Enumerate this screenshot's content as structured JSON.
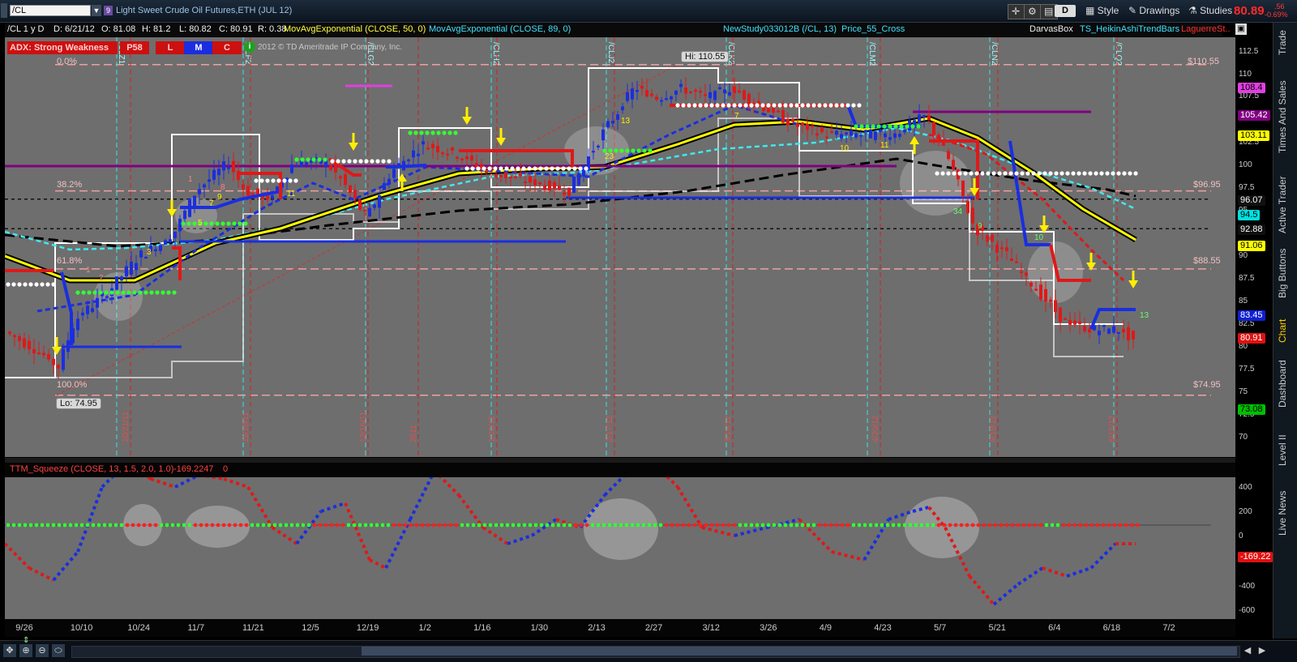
{
  "toolbar": {
    "symbol": "/CL",
    "link_badge": "9",
    "description": "Light Sweet Crude Oil Futures,ETH (JUL 12)",
    "aggregation": "D",
    "style_label": "Style",
    "drawings_label": "Drawings",
    "studies_label": "Studies",
    "last_price": "80.89",
    "change": ".56",
    "change_pct": "-0.69%"
  },
  "header": {
    "period": "/CL 1 y D",
    "date": "D: 6/21/12",
    "open": "O: 81.08",
    "high": "H: 81.2",
    "low": "L: 80.82",
    "close": "C: 80.91",
    "range": "R: 0.38",
    "studies": [
      "MovAvgExponential (CLOSE, 50, 0)",
      "MovAvgExponential (CLOSE, 89, 0)",
      "NewStudy033012B (/CL, 13)",
      "Price_55_Cross",
      "DarvasBox",
      "TS_HeikinAshiTrendBars",
      "LaguerreSt..."
    ]
  },
  "adx": {
    "label": "ADX: Strong Weakness",
    "tags": [
      "P58",
      "L",
      "M",
      "C"
    ],
    "copyright": "2012 © TD Ameritrade IP Company, Inc."
  },
  "price_chart": {
    "hi_label": "Hi: 110.55",
    "lo_label": "Lo: 74.95",
    "fib_levels": [
      {
        "label": "0.0%",
        "price": "$110.55"
      },
      {
        "label": "38.2%",
        "price": "$96.95"
      },
      {
        "label": "61.8%",
        "price": "$88.55"
      },
      {
        "label": "100.0%",
        "price": "$74.95"
      }
    ],
    "axis_ticks": [
      "112.5",
      "110",
      "107.5",
      "105",
      "102.5",
      "100",
      "97.5",
      "95",
      "92.5",
      "90",
      "87.5",
      "85",
      "82.5",
      "80",
      "77.5",
      "75",
      "72.5",
      "70"
    ],
    "price_tags": [
      {
        "value": "108.4",
        "bg": "#e040e0",
        "fg": "#000"
      },
      {
        "value": "105.42",
        "bg": "#800080",
        "fg": "#fff"
      },
      {
        "value": "103.11",
        "bg": "#ffff00",
        "fg": "#000"
      },
      {
        "value": "96.07",
        "bg": "#101010",
        "fg": "#fff"
      },
      {
        "value": "94.5",
        "bg": "#00e0e0",
        "fg": "#000"
      },
      {
        "value": "92.88",
        "bg": "#101010",
        "fg": "#fff"
      },
      {
        "value": "91.06",
        "bg": "#ffff00",
        "fg": "#000"
      },
      {
        "value": "83.45",
        "bg": "#1020d0",
        "fg": "#fff"
      },
      {
        "value": "80.91",
        "bg": "#e01010",
        "fg": "#fff"
      },
      {
        "value": "73.08",
        "bg": "#00c000",
        "fg": "#000"
      }
    ],
    "expiry_labels": [
      "/CLZ1",
      "/CLF2",
      "/CLG2",
      "/CLH2",
      "/CLJ2",
      "/CLK2",
      "/CLM2",
      "/CLN2",
      "/CLQ2"
    ],
    "date_markers": [
      "10/21/11",
      "11/18/11",
      "12/16/11",
      "2011",
      "1/20/12",
      "2/17/12",
      "3/16/12",
      "4/20/12",
      "5/18/12",
      "6/15/12"
    ],
    "bar_counts": [
      "1",
      "2",
      "3",
      "4",
      "5",
      "6",
      "7",
      "8",
      "9",
      "10",
      "11",
      "12",
      "13",
      "23",
      "34"
    ]
  },
  "squeeze": {
    "label": "TTM_Squeeze (CLOSE, 13, 1.5, 2.0, 1.0)",
    "value": "-169.2247",
    "flag": "0",
    "axis_ticks": [
      "400",
      "200",
      "0",
      "-200",
      "-400",
      "-600"
    ],
    "current_tag": "-169.22"
  },
  "time_axis": [
    "9/26",
    "10/10",
    "10/24",
    "11/7",
    "11/21",
    "12/5",
    "12/19",
    "1/2",
    "1/16",
    "1/30",
    "2/13",
    "2/27",
    "3/12",
    "3/26",
    "4/9",
    "4/23",
    "5/7",
    "5/21",
    "6/4",
    "6/18",
    "7/2"
  ],
  "sidebar": [
    "Trade",
    "Times And Sales",
    "Active Trader",
    "Big Buttons",
    "Chart",
    "Dashboard",
    "Level II",
    "Live News"
  ],
  "colors": {
    "chart_bg": "#6e6e6e",
    "up_bar": "#1a2ee0",
    "down_bar": "#e01818",
    "ema50": "#ffff00",
    "ema89": "#000000"
  }
}
